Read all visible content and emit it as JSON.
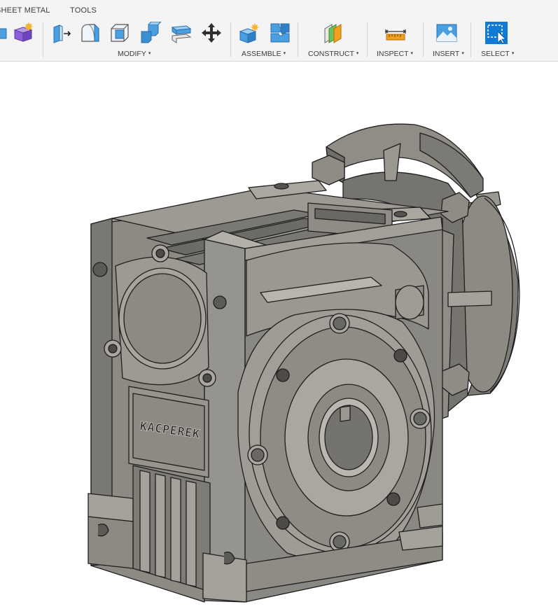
{
  "ribbon": {
    "tabs": [
      {
        "label": "SHEET METAL"
      },
      {
        "label": "TOOLS"
      }
    ],
    "groups": {
      "modify": {
        "label": "MODIFY"
      },
      "assemble": {
        "label": "ASSEMBLE"
      },
      "construct": {
        "label": "CONSTRUCT"
      },
      "inspect": {
        "label": "INSPECT"
      },
      "insert": {
        "label": "INSERT"
      },
      "select": {
        "label": "SELECT"
      }
    },
    "caret": "▾",
    "icons": [
      "new-component-icon",
      "press-pull-icon",
      "fillet-icon",
      "chamfer-icon",
      "shell-icon",
      "combine-icon",
      "move-copy-icon",
      "new-joint-component-icon",
      "joint-icon",
      "offset-plane-icon",
      "measure-icon",
      "insert-canvas-icon",
      "select-icon"
    ],
    "colors": {
      "accent_blue": "#4a9fe0",
      "select_blue": "#0f7bd6",
      "purple": "#8c5fd8",
      "orange": "#f0a020"
    }
  },
  "viewport": {
    "model": {
      "engraving": "KACPEREK",
      "colors": {
        "body": "#8c8a83",
        "light": "#a9a7a0",
        "dark": "#5c5a55",
        "edge": "#1e1e1e"
      }
    }
  }
}
